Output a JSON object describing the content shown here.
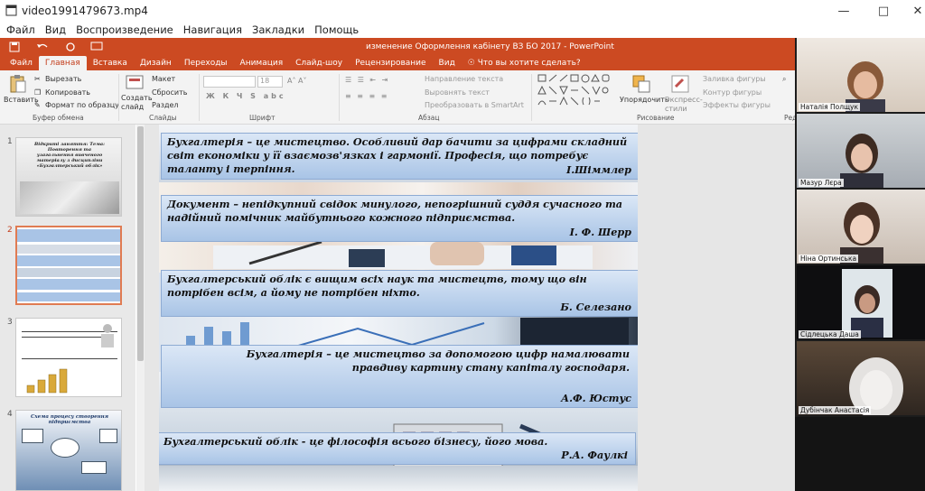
{
  "window": {
    "title": "video1991479673.mp4"
  },
  "menu": [
    "Файл",
    "Вид",
    "Воспроизведение",
    "Навигация",
    "Закладки",
    "Помощь"
  ],
  "ppt": {
    "doc_title": "изменение Оформлення кабінету ВЗ БО 2017  -  PowerPoint",
    "tabs": [
      "Файл",
      "Главная",
      "Вставка",
      "Дизайн",
      "Переходы",
      "Анимация",
      "Слайд-шоу",
      "Рецензирование",
      "Вид"
    ],
    "tell_me": "Что вы хотите сделать?",
    "ribbon": {
      "paste": "Вставить",
      "cut": "Вырезать",
      "copy": "Копировать",
      "format_painter": "Формат по образцу",
      "clipboard_label": "Буфер обмена",
      "new_slide": "Создать слайд",
      "layout": "Макет",
      "reset": "Сбросить",
      "section": "Раздел",
      "slides_label": "Слайды",
      "font_size": "18",
      "font_label": "Шрифт",
      "text_direction": "Направление текста",
      "align_text": "Выровнять текст",
      "smartart": "Преобразовать в SmartArt",
      "paragraph_label": "Абзац",
      "arrange": "Упорядочить",
      "quick_styles": "Экспресс-стили",
      "shape_fill": "Заливка фигуры",
      "shape_outline": "Контур фигуры",
      "shape_effects": "Эффекты фигуры",
      "drawing_label": "Рисование",
      "editing_label": "Ред"
    },
    "thumbnails": [
      {
        "num": "1",
        "title": "Відкриті заняття: Тема: Повторення та узагальнення вивченого матеріалу з дисципліни «Бухгалтерський облік»"
      },
      {
        "num": "2"
      },
      {
        "num": "3"
      },
      {
        "num": "4",
        "title": "Схема процесу створення підприємства"
      }
    ],
    "quotes": [
      {
        "text": "Бухгалтерія – це мистецтво. Особливий дар бачити за цифрами складний світ економіки у її взаємозв'язках і гармонії. Професія, що потребує таланту і терпіння.",
        "author": "І.Шіммлер"
      },
      {
        "text": "Документ – непідкупний свідок минулого, непогрішний суддя сучасного та надійний помічник майбутнього кожного підприємства.",
        "author": "І. Ф. Шерр"
      },
      {
        "text": "Бухгалтерський облік є вищим всіх наук та мистецтв, тому що він потрібен всім, а йому не потрібен ніхто.",
        "author": "Б. Селезано"
      },
      {
        "text": "Бухгалтерія – це мистецтво за допомогою цифр намалювати правдиву картину стану капіталу господаря.",
        "author": "А.Ф. Юстус"
      },
      {
        "text": "Бухгалтерський облік -  це філософія всього бізнесу,  його мова.",
        "author": "Р.А. Фаулкі"
      }
    ]
  },
  "participants": [
    "Наталія Полщук",
    "Мазур Лєра",
    "Ніна Ортинська",
    "Сідлецька Даша",
    "Дубінчак Анастасія"
  ],
  "colors": {
    "ppt_accent": "#cc4a22",
    "quote_box": "#b8cfec"
  }
}
